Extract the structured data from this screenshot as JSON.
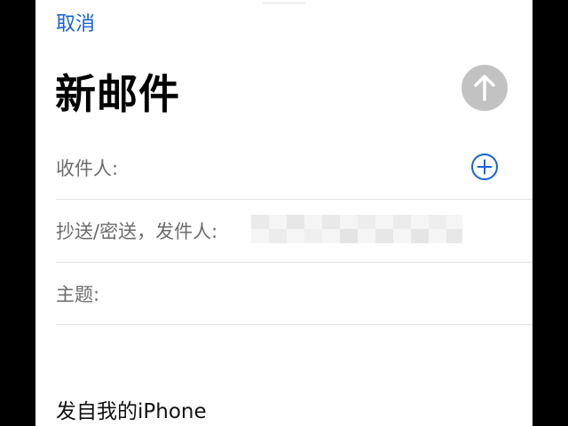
{
  "header": {
    "cancel_label": "取消",
    "title": "新邮件",
    "send_icon": "arrow-up-icon"
  },
  "fields": {
    "to_label": "收件人:",
    "add_recipient_icon": "plus-circle-icon",
    "cc_label": "抄送/密送，发件人:",
    "from_value_redacted": true,
    "subject_label": "主题:"
  },
  "body": {
    "signature": "发自我的iPhone"
  },
  "colors": {
    "accent": "#1463d6",
    "send_disabled": "#c2c2c2",
    "separator": "#e2e2e2",
    "label": "#6b6b6b"
  }
}
